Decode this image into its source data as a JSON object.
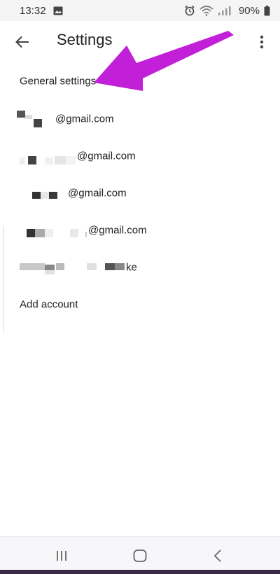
{
  "status_bar": {
    "time": "13:32",
    "battery": "90%",
    "icons": [
      "image-icon",
      "alarm-icon",
      "wifi-icon",
      "signal-icon",
      "battery-icon"
    ]
  },
  "app_bar": {
    "title": "Settings",
    "back_icon": "back-arrow-icon",
    "menu_icon": "more-vert-icon"
  },
  "list": {
    "general_settings": "General settings",
    "accounts": [
      {
        "suffix": "@gmail.com"
      },
      {
        "suffix": "@gmail.com"
      },
      {
        "suffix": "@gmail.com"
      },
      {
        "suffix": "@gmail.com"
      },
      {
        "suffix": "ke"
      }
    ],
    "add_account": "Add account"
  },
  "annotation": {
    "arrow_color": "#c21fd8"
  },
  "nav_bar": {
    "icons": [
      "recents-icon",
      "home-icon",
      "back-icon"
    ]
  }
}
